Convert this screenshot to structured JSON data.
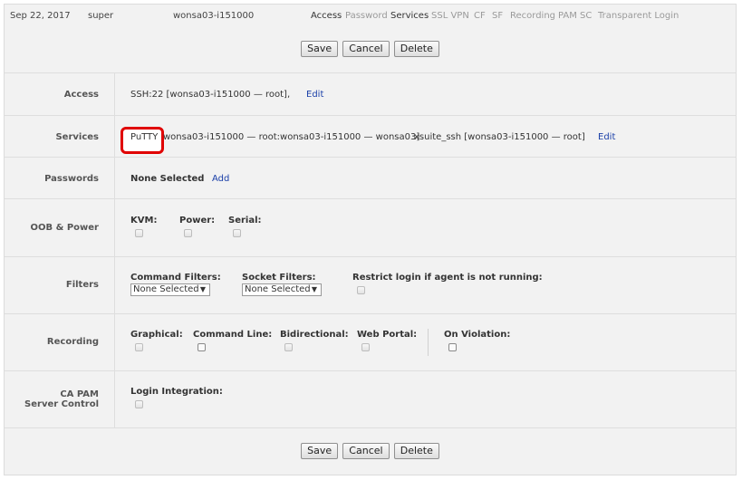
{
  "topbar": {
    "date": "Sep 22, 2017",
    "user": "super",
    "device": "wonsa03-i151000",
    "tabs": [
      "Access",
      "Password",
      "Services",
      "SSL VPN",
      "CF",
      "SF",
      "Recording",
      "PAM SC",
      "Transparent Login"
    ],
    "active_tabs": [
      "Access",
      "Services"
    ]
  },
  "buttons": {
    "save": "Save",
    "cancel": "Cancel",
    "delete": "Delete"
  },
  "rows": {
    "access": {
      "label": "Access",
      "value": "SSH:22 [wonsa03-i151000 — root],",
      "edit": "Edit"
    },
    "services": {
      "label": "Services",
      "highlight": "PuTTY",
      "value1": "wonsa03-i151000 — root:wonsa03-i151000 — wonsa03]",
      "value2": "xsuite_ssh [wonsa03-i151000 — root]",
      "edit": "Edit"
    },
    "passwords": {
      "label": "Passwords",
      "value": "None Selected",
      "add": "Add"
    },
    "oob": {
      "label": "OOB & Power",
      "kvm": "KVM:",
      "power": "Power:",
      "serial": "Serial:"
    },
    "filters": {
      "label": "Filters",
      "command_filters": "Command Filters:",
      "command_select": "None Selected",
      "socket_filters": "Socket Filters:",
      "socket_select": "None Selected",
      "restrict": "Restrict login if agent is not running:"
    },
    "recording": {
      "label": "Recording",
      "graphical": "Graphical:",
      "command_line": "Command Line:",
      "bidirectional": "Bidirectional:",
      "web_portal": "Web Portal:",
      "on_violation": "On Violation:"
    },
    "capam": {
      "label_line1": "CA PAM",
      "label_line2": "Server Control",
      "login_integration": "Login Integration:"
    }
  }
}
